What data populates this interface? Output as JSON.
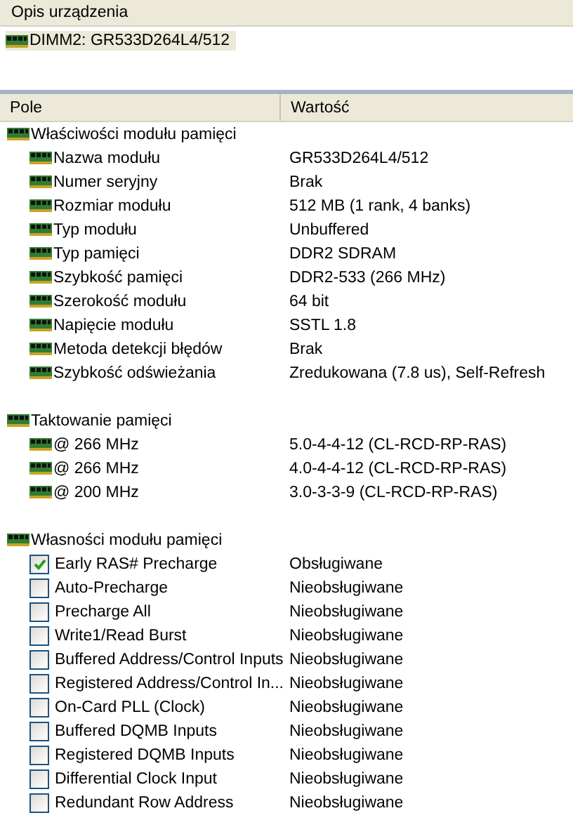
{
  "device_panel": {
    "title": "Opis urządzenia",
    "device": {
      "label": "DIMM2: GR533D264L4/512",
      "selected": true
    }
  },
  "table": {
    "columns": [
      "Pole",
      "Wartość"
    ],
    "groups": [
      {
        "label": "Właściwości modułu pamięci",
        "rows": [
          {
            "kind": "icon",
            "field": "Nazwa modułu",
            "value": "GR533D264L4/512"
          },
          {
            "kind": "icon",
            "field": "Numer seryjny",
            "value": "Brak"
          },
          {
            "kind": "icon",
            "field": "Rozmiar modułu",
            "value": "512 MB (1 rank, 4 banks)"
          },
          {
            "kind": "icon",
            "field": "Typ modułu",
            "value": "Unbuffered"
          },
          {
            "kind": "icon",
            "field": "Typ pamięci",
            "value": "DDR2 SDRAM"
          },
          {
            "kind": "icon",
            "field": "Szybkość pamięci",
            "value": "DDR2-533 (266 MHz)"
          },
          {
            "kind": "icon",
            "field": "Szerokość modułu",
            "value": "64 bit"
          },
          {
            "kind": "icon",
            "field": "Napięcie modułu",
            "value": "SSTL 1.8"
          },
          {
            "kind": "icon",
            "field": "Metoda detekcji błędów",
            "value": "Brak"
          },
          {
            "kind": "icon",
            "field": "Szybkość odświeżania",
            "value": "Zredukowana (7.8 us), Self-Refresh"
          }
        ]
      },
      {
        "label": "Taktowanie pamięci",
        "rows": [
          {
            "kind": "icon",
            "field": "@ 266 MHz",
            "value": "5.0-4-4-12  (CL-RCD-RP-RAS)"
          },
          {
            "kind": "icon",
            "field": "@ 266 MHz",
            "value": "4.0-4-4-12  (CL-RCD-RP-RAS)"
          },
          {
            "kind": "icon",
            "field": "@ 200 MHz",
            "value": "3.0-3-3-9  (CL-RCD-RP-RAS)"
          }
        ]
      },
      {
        "label": "Własności modułu pamięci",
        "rows": [
          {
            "kind": "checkbox",
            "checked": true,
            "field": "Early RAS# Precharge",
            "value": "Obsługiwane"
          },
          {
            "kind": "checkbox",
            "checked": false,
            "field": "Auto-Precharge",
            "value": "Nieobsługiwane"
          },
          {
            "kind": "checkbox",
            "checked": false,
            "field": "Precharge All",
            "value": "Nieobsługiwane"
          },
          {
            "kind": "checkbox",
            "checked": false,
            "field": "Write1/Read Burst",
            "value": "Nieobsługiwane"
          },
          {
            "kind": "checkbox",
            "checked": false,
            "field": "Buffered Address/Control Inputs",
            "value": "Nieobsługiwane"
          },
          {
            "kind": "checkbox",
            "checked": false,
            "field": "Registered Address/Control In...",
            "value": "Nieobsługiwane"
          },
          {
            "kind": "checkbox",
            "checked": false,
            "field": "On-Card PLL (Clock)",
            "value": "Nieobsługiwane"
          },
          {
            "kind": "checkbox",
            "checked": false,
            "field": "Buffered DQMB Inputs",
            "value": "Nieobsługiwane"
          },
          {
            "kind": "checkbox",
            "checked": false,
            "field": "Registered DQMB Inputs",
            "value": "Nieobsługiwane"
          },
          {
            "kind": "checkbox",
            "checked": false,
            "field": "Differential Clock Input",
            "value": "Nieobsługiwane"
          },
          {
            "kind": "checkbox",
            "checked": false,
            "field": "Redundant Row Address",
            "value": "Nieobsługiwane"
          }
        ]
      }
    ]
  }
}
